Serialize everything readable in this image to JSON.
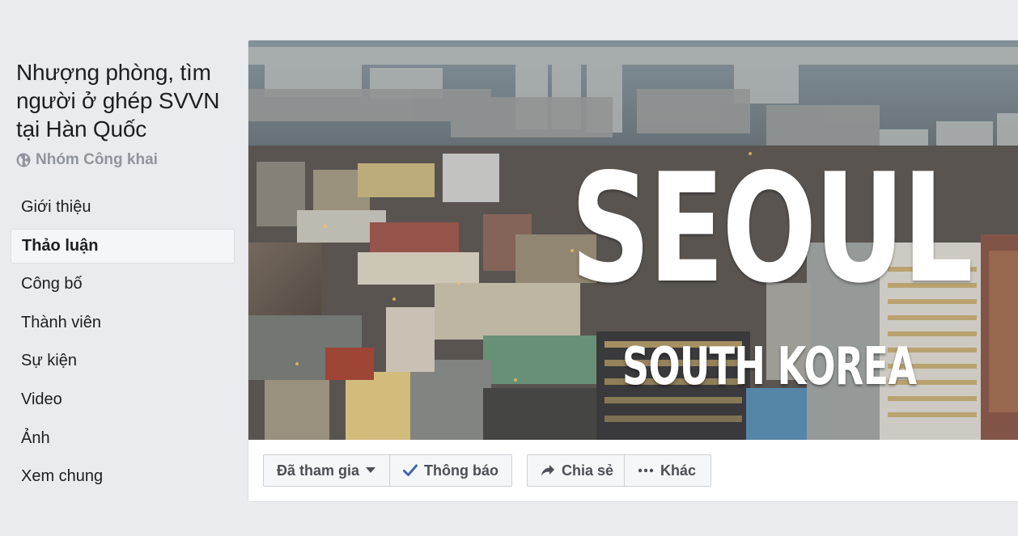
{
  "group": {
    "title": "Nhượng phòng, tìm người ở ghép SVVN tại Hàn Quốc",
    "privacy": "Nhóm Công khai",
    "privacy_icon": "globe-icon"
  },
  "nav": {
    "items": [
      {
        "label": "Giới thiệu"
      },
      {
        "label": "Thảo luận",
        "active": true
      },
      {
        "label": "Công bố"
      },
      {
        "label": "Thành viên"
      },
      {
        "label": "Sự kiện"
      },
      {
        "label": "Video"
      },
      {
        "label": "Ảnh"
      },
      {
        "label": "Xem chung"
      }
    ]
  },
  "cover": {
    "title": "SEOUL",
    "subtitle": "SOUTH KOREA"
  },
  "actions": {
    "joined_label": "Đã tham gia",
    "joined_icon": "caret-down-icon",
    "notify_label": "Thông báo",
    "notify_icon": "checkmark-icon",
    "share_label": "Chia sẻ",
    "share_icon": "share-arrow-icon",
    "more_label": "Khác",
    "more_icon": "ellipsis-icon"
  },
  "colors": {
    "page_bg": "#e9ebee",
    "button_bg": "#f5f6f7",
    "button_text": "#4b4f56",
    "checkmark": "#4267b2",
    "muted_text": "#90949c"
  }
}
